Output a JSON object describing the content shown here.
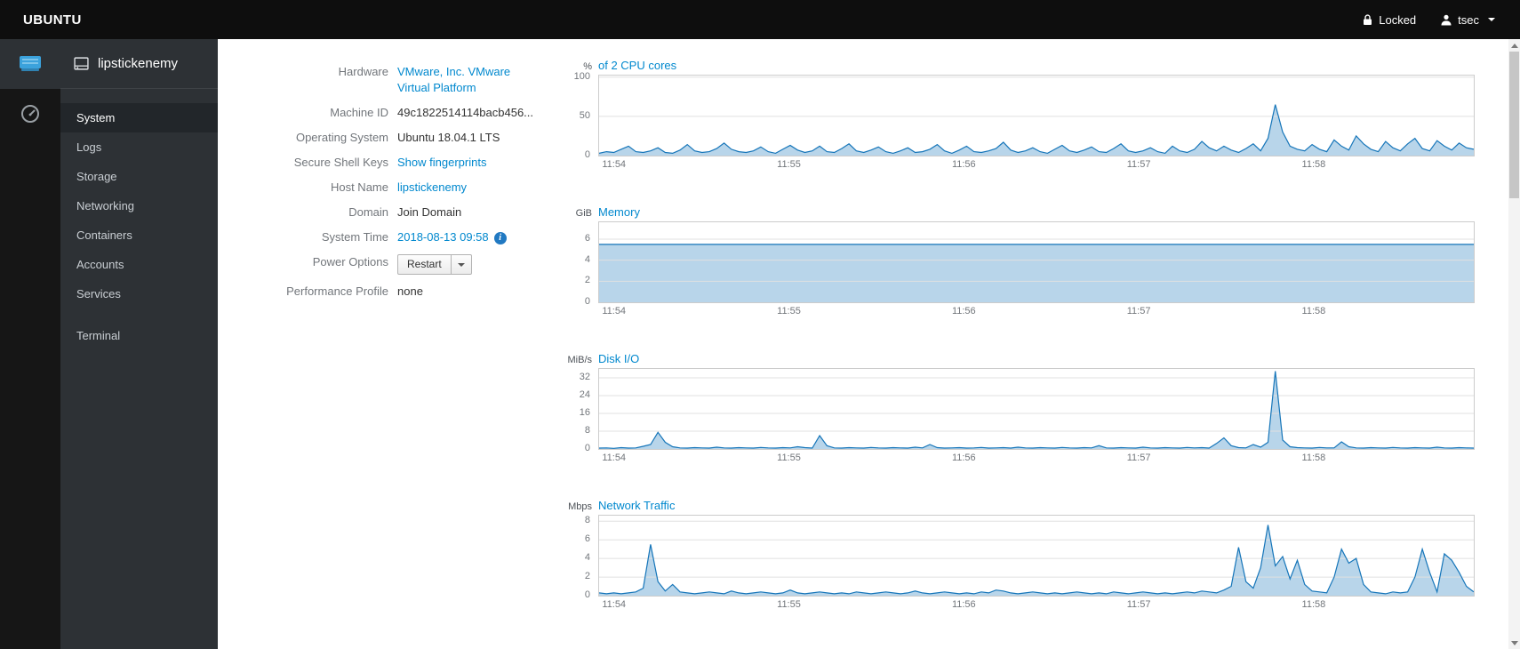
{
  "topbar": {
    "brand": "UBUNTU",
    "locked_label": "Locked",
    "user_label": "tsec"
  },
  "sidebar": {
    "host": "lipstickenemy",
    "items": [
      {
        "label": "System",
        "active": true
      },
      {
        "label": "Logs"
      },
      {
        "label": "Storage"
      },
      {
        "label": "Networking"
      },
      {
        "label": "Containers"
      },
      {
        "label": "Accounts"
      },
      {
        "label": "Services"
      }
    ],
    "tools": [
      {
        "label": "Terminal"
      }
    ]
  },
  "info": {
    "rows": [
      {
        "label": "Hardware",
        "value": "VMware, Inc. VMware Virtual Platform",
        "type": "link"
      },
      {
        "label": "Machine ID",
        "value": "49c1822514114bacb456...",
        "type": "text"
      },
      {
        "label": "Operating System",
        "value": "Ubuntu 18.04.1 LTS",
        "type": "text"
      },
      {
        "label": "Secure Shell Keys",
        "value": "Show fingerprints",
        "type": "link"
      },
      {
        "label": "Host Name",
        "value": "lipstickenemy",
        "type": "link"
      },
      {
        "label": "Domain",
        "value": "Join Domain",
        "type": "text"
      },
      {
        "label": "System Time",
        "value": "2018-08-13 09:58",
        "type": "link",
        "info_icon": true
      },
      {
        "label": "Power Options",
        "value": "Restart",
        "type": "button"
      },
      {
        "label": "Performance Profile",
        "value": "none",
        "type": "text"
      }
    ]
  },
  "chart_data": [
    {
      "type": "area",
      "unit": "%",
      "title": "of 2 CPU cores",
      "x_ticks": [
        "11:54",
        "11:55",
        "11:56",
        "11:57",
        "11:58"
      ],
      "y_ticks": [
        0,
        50,
        100
      ],
      "ymax": 102,
      "values": [
        3,
        5,
        4,
        8,
        12,
        5,
        4,
        6,
        10,
        4,
        3,
        7,
        14,
        6,
        4,
        5,
        9,
        16,
        8,
        5,
        4,
        6,
        11,
        5,
        3,
        8,
        13,
        7,
        4,
        6,
        12,
        5,
        4,
        9,
        15,
        6,
        4,
        7,
        11,
        5,
        3,
        6,
        10,
        4,
        5,
        8,
        14,
        6,
        3,
        7,
        12,
        5,
        4,
        6,
        9,
        17,
        7,
        4,
        6,
        10,
        5,
        3,
        8,
        13,
        6,
        4,
        7,
        11,
        5,
        4,
        9,
        15,
        6,
        4,
        6,
        10,
        5,
        3,
        12,
        6,
        4,
        8,
        18,
        10,
        6,
        12,
        7,
        4,
        9,
        15,
        6,
        22,
        65,
        30,
        12,
        8,
        6,
        14,
        8,
        5,
        20,
        12,
        7,
        25,
        15,
        8,
        5,
        18,
        10,
        6,
        15,
        22,
        9,
        6,
        19,
        12,
        7,
        16,
        10,
        8
      ]
    },
    {
      "type": "area",
      "unit": "GiB",
      "title": "Memory",
      "x_ticks": [
        "11:54",
        "11:55",
        "11:56",
        "11:57",
        "11:58"
      ],
      "y_ticks": [
        0,
        2,
        4,
        6
      ],
      "ymax": 7.6,
      "values": [
        5.5,
        5.5,
        5.5,
        5.5,
        5.5,
        5.5,
        5.5,
        5.5,
        5.5,
        5.5,
        5.5,
        5.5
      ]
    },
    {
      "type": "area",
      "unit": "MiB/s",
      "title": "Disk I/O",
      "x_ticks": [
        "11:54",
        "11:55",
        "11:56",
        "11:57",
        "11:58"
      ],
      "y_ticks": [
        0,
        8,
        16,
        24,
        32
      ],
      "ymax": 36,
      "values": [
        0.4,
        0.5,
        0.3,
        0.6,
        0.4,
        0.5,
        1.2,
        2.0,
        7.5,
        3.0,
        1.0,
        0.5,
        0.4,
        0.6,
        0.5,
        0.4,
        0.8,
        0.5,
        0.4,
        0.6,
        0.5,
        0.4,
        0.7,
        0.5,
        0.4,
        0.6,
        0.5,
        1.0,
        0.6,
        0.4,
        6.0,
        1.5,
        0.5,
        0.4,
        0.6,
        0.5,
        0.4,
        0.7,
        0.5,
        0.4,
        0.6,
        0.5,
        0.4,
        0.8,
        0.5,
        2.0,
        0.6,
        0.4,
        0.5,
        0.6,
        0.4,
        0.5,
        0.7,
        0.4,
        0.5,
        0.6,
        0.4,
        0.8,
        0.5,
        0.4,
        0.6,
        0.5,
        0.4,
        0.7,
        0.5,
        0.4,
        0.6,
        0.5,
        1.5,
        0.5,
        0.4,
        0.6,
        0.5,
        0.4,
        0.8,
        0.5,
        0.4,
        0.6,
        0.5,
        0.4,
        0.7,
        0.5,
        0.6,
        0.4,
        2.5,
        5.0,
        1.5,
        0.6,
        0.5,
        2.0,
        0.8,
        3.0,
        35.0,
        4.0,
        1.0,
        0.6,
        0.5,
        0.4,
        0.7,
        0.5,
        0.5,
        3.2,
        1.0,
        0.5,
        0.4,
        0.6,
        0.5,
        0.4,
        0.7,
        0.5,
        0.4,
        0.6,
        0.5,
        0.4,
        0.8,
        0.5,
        0.4,
        0.6,
        0.5,
        0.4
      ]
    },
    {
      "type": "area",
      "unit": "Mbps",
      "title": "Network Traffic",
      "x_ticks": [
        "11:54",
        "11:55",
        "11:56",
        "11:57",
        "11:58"
      ],
      "y_ticks": [
        0,
        2,
        4,
        6,
        8
      ],
      "ymax": 8.6,
      "values": [
        0.3,
        0.2,
        0.3,
        0.2,
        0.3,
        0.4,
        0.8,
        5.5,
        1.5,
        0.5,
        1.2,
        0.4,
        0.3,
        0.2,
        0.3,
        0.4,
        0.3,
        0.2,
        0.5,
        0.3,
        0.2,
        0.3,
        0.4,
        0.3,
        0.2,
        0.3,
        0.6,
        0.3,
        0.2,
        0.3,
        0.4,
        0.3,
        0.2,
        0.3,
        0.2,
        0.4,
        0.3,
        0.2,
        0.3,
        0.4,
        0.3,
        0.2,
        0.3,
        0.5,
        0.3,
        0.2,
        0.3,
        0.4,
        0.3,
        0.2,
        0.3,
        0.2,
        0.4,
        0.3,
        0.6,
        0.5,
        0.3,
        0.2,
        0.3,
        0.4,
        0.3,
        0.2,
        0.3,
        0.2,
        0.3,
        0.4,
        0.3,
        0.2,
        0.3,
        0.2,
        0.4,
        0.3,
        0.2,
        0.3,
        0.4,
        0.3,
        0.2,
        0.3,
        0.2,
        0.3,
        0.4,
        0.3,
        0.5,
        0.4,
        0.3,
        0.6,
        1.0,
        5.2,
        1.5,
        0.8,
        3.0,
        7.6,
        3.2,
        4.2,
        1.8,
        3.8,
        1.2,
        0.5,
        0.4,
        0.3,
        2.0,
        5.0,
        3.5,
        4.0,
        1.2,
        0.4,
        0.3,
        0.2,
        0.4,
        0.3,
        0.4,
        2.0,
        5.0,
        2.5,
        0.4,
        4.5,
        3.8,
        2.5,
        1.0,
        0.4
      ]
    }
  ],
  "icons": {
    "lock": "padlock",
    "user": "person-silhouette",
    "caret": "chevron-down",
    "info": "circled-i",
    "app_server": "server",
    "app_dashboard": "gauge",
    "host": "server-outline",
    "scroll_up": "triangle-up",
    "scroll_down": "triangle-down"
  },
  "colors": {
    "accent": "#0088ce",
    "chart_line": "#1575b9",
    "chart_fill": "rgba(21,117,185,0.3)",
    "grid_line": "#e0e0e0",
    "topbar_bg": "#0e0e0e",
    "sidebar_bg": "#2d3135",
    "active_item_bg": "#22262a"
  }
}
